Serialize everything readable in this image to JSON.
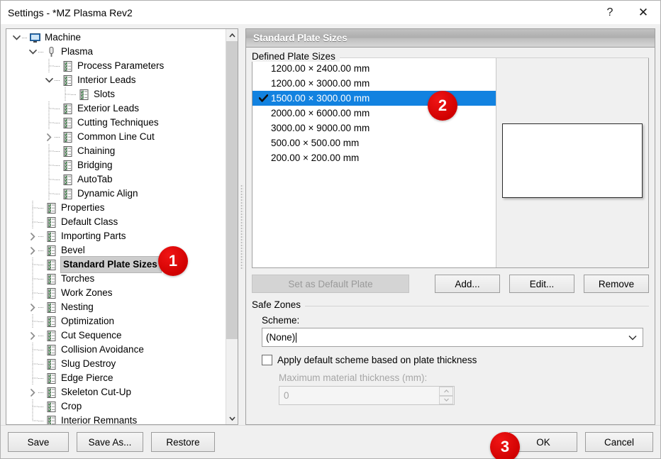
{
  "window": {
    "title": "Settings - *MZ Plasma Rev2",
    "help_label": "?",
    "close_label": "✕"
  },
  "tree": {
    "items": [
      {
        "label": "Machine",
        "depth": 0,
        "twisty": "expanded",
        "icon": "monitor-icon",
        "selected": false
      },
      {
        "label": "Plasma",
        "depth": 1,
        "twisty": "expanded",
        "icon": "torch-icon",
        "selected": false
      },
      {
        "label": "Process Parameters",
        "depth": 2,
        "twisty": "none",
        "icon": "checklist-icon",
        "selected": false
      },
      {
        "label": "Interior Leads",
        "depth": 2,
        "twisty": "expanded",
        "icon": "checklist-icon",
        "selected": false
      },
      {
        "label": "Slots",
        "depth": 3,
        "twisty": "none",
        "icon": "checklist-icon",
        "selected": false
      },
      {
        "label": "Exterior Leads",
        "depth": 2,
        "twisty": "none",
        "icon": "checklist-icon",
        "selected": false
      },
      {
        "label": "Cutting Techniques",
        "depth": 2,
        "twisty": "none",
        "icon": "checklist-icon",
        "selected": false
      },
      {
        "label": "Common Line Cut",
        "depth": 2,
        "twisty": "collapsed",
        "icon": "checklist-icon",
        "selected": false
      },
      {
        "label": "Chaining",
        "depth": 2,
        "twisty": "none",
        "icon": "checklist-icon",
        "selected": false
      },
      {
        "label": "Bridging",
        "depth": 2,
        "twisty": "none",
        "icon": "checklist-icon",
        "selected": false
      },
      {
        "label": "AutoTab",
        "depth": 2,
        "twisty": "none",
        "icon": "checklist-icon",
        "selected": false
      },
      {
        "label": "Dynamic Align",
        "depth": 2,
        "twisty": "none",
        "icon": "checklist-icon",
        "selected": false
      },
      {
        "label": "Properties",
        "depth": 1,
        "twisty": "none",
        "icon": "checklist-icon",
        "selected": false
      },
      {
        "label": "Default Class",
        "depth": 1,
        "twisty": "none",
        "icon": "checklist-icon",
        "selected": false
      },
      {
        "label": "Importing Parts",
        "depth": 1,
        "twisty": "collapsed",
        "icon": "checklist-icon",
        "selected": false
      },
      {
        "label": "Bevel",
        "depth": 1,
        "twisty": "collapsed",
        "icon": "checklist-icon",
        "selected": false
      },
      {
        "label": "Standard Plate Sizes",
        "depth": 1,
        "twisty": "none",
        "icon": "checklist-icon",
        "selected": true
      },
      {
        "label": "Torches",
        "depth": 1,
        "twisty": "none",
        "icon": "checklist-icon",
        "selected": false
      },
      {
        "label": "Work Zones",
        "depth": 1,
        "twisty": "none",
        "icon": "checklist-icon",
        "selected": false
      },
      {
        "label": "Nesting",
        "depth": 1,
        "twisty": "collapsed",
        "icon": "checklist-icon",
        "selected": false
      },
      {
        "label": "Optimization",
        "depth": 1,
        "twisty": "none",
        "icon": "checklist-icon",
        "selected": false
      },
      {
        "label": "Cut Sequence",
        "depth": 1,
        "twisty": "collapsed",
        "icon": "checklist-icon",
        "selected": false
      },
      {
        "label": "Collision Avoidance",
        "depth": 1,
        "twisty": "none",
        "icon": "checklist-icon",
        "selected": false
      },
      {
        "label": "Slug Destroy",
        "depth": 1,
        "twisty": "none",
        "icon": "checklist-icon",
        "selected": false
      },
      {
        "label": "Edge Pierce",
        "depth": 1,
        "twisty": "none",
        "icon": "checklist-icon",
        "selected": false
      },
      {
        "label": "Skeleton Cut-Up",
        "depth": 1,
        "twisty": "collapsed",
        "icon": "checklist-icon",
        "selected": false
      },
      {
        "label": "Crop",
        "depth": 1,
        "twisty": "none",
        "icon": "checklist-icon",
        "selected": false
      },
      {
        "label": "Interior Remnants",
        "depth": 1,
        "twisty": "none",
        "icon": "checklist-icon",
        "selected": false
      }
    ]
  },
  "panel": {
    "header_title": "Standard Plate Sizes",
    "defined_group_label": "Defined Plate Sizes",
    "plates": [
      {
        "label": "1200.00 × 2400.00 mm",
        "checked": false,
        "selected": false
      },
      {
        "label": "1200.00 × 3000.00 mm",
        "checked": false,
        "selected": false
      },
      {
        "label": "1500.00 × 3000.00 mm",
        "checked": true,
        "selected": true
      },
      {
        "label": "2000.00 × 6000.00 mm",
        "checked": false,
        "selected": false
      },
      {
        "label": "3000.00 × 9000.00 mm",
        "checked": false,
        "selected": false
      },
      {
        "label": "500.00 × 500.00 mm",
        "checked": false,
        "selected": false
      },
      {
        "label": "200.00 × 200.00 mm",
        "checked": false,
        "selected": false
      }
    ],
    "buttons": {
      "set_default": "Set as Default Plate",
      "add": "Add...",
      "edit": "Edit...",
      "remove": "Remove"
    },
    "safe_zones": {
      "group_label": "Safe Zones",
      "scheme_label": "Scheme:",
      "scheme_value": "(None)",
      "apply_default_label": "Apply default scheme based on plate thickness",
      "apply_default_checked": false,
      "max_thickness_label": "Maximum material thickness (mm):",
      "max_thickness_value": "0"
    }
  },
  "footer": {
    "save": "Save",
    "save_as": "Save As...",
    "restore": "Restore",
    "ok": "OK",
    "cancel": "Cancel"
  },
  "badges": {
    "one": "1",
    "two": "2",
    "three": "3"
  },
  "colors": {
    "selection_blue": "#1282e0",
    "badge_red": "#d40000",
    "window_bg": "#f0f0f0"
  }
}
